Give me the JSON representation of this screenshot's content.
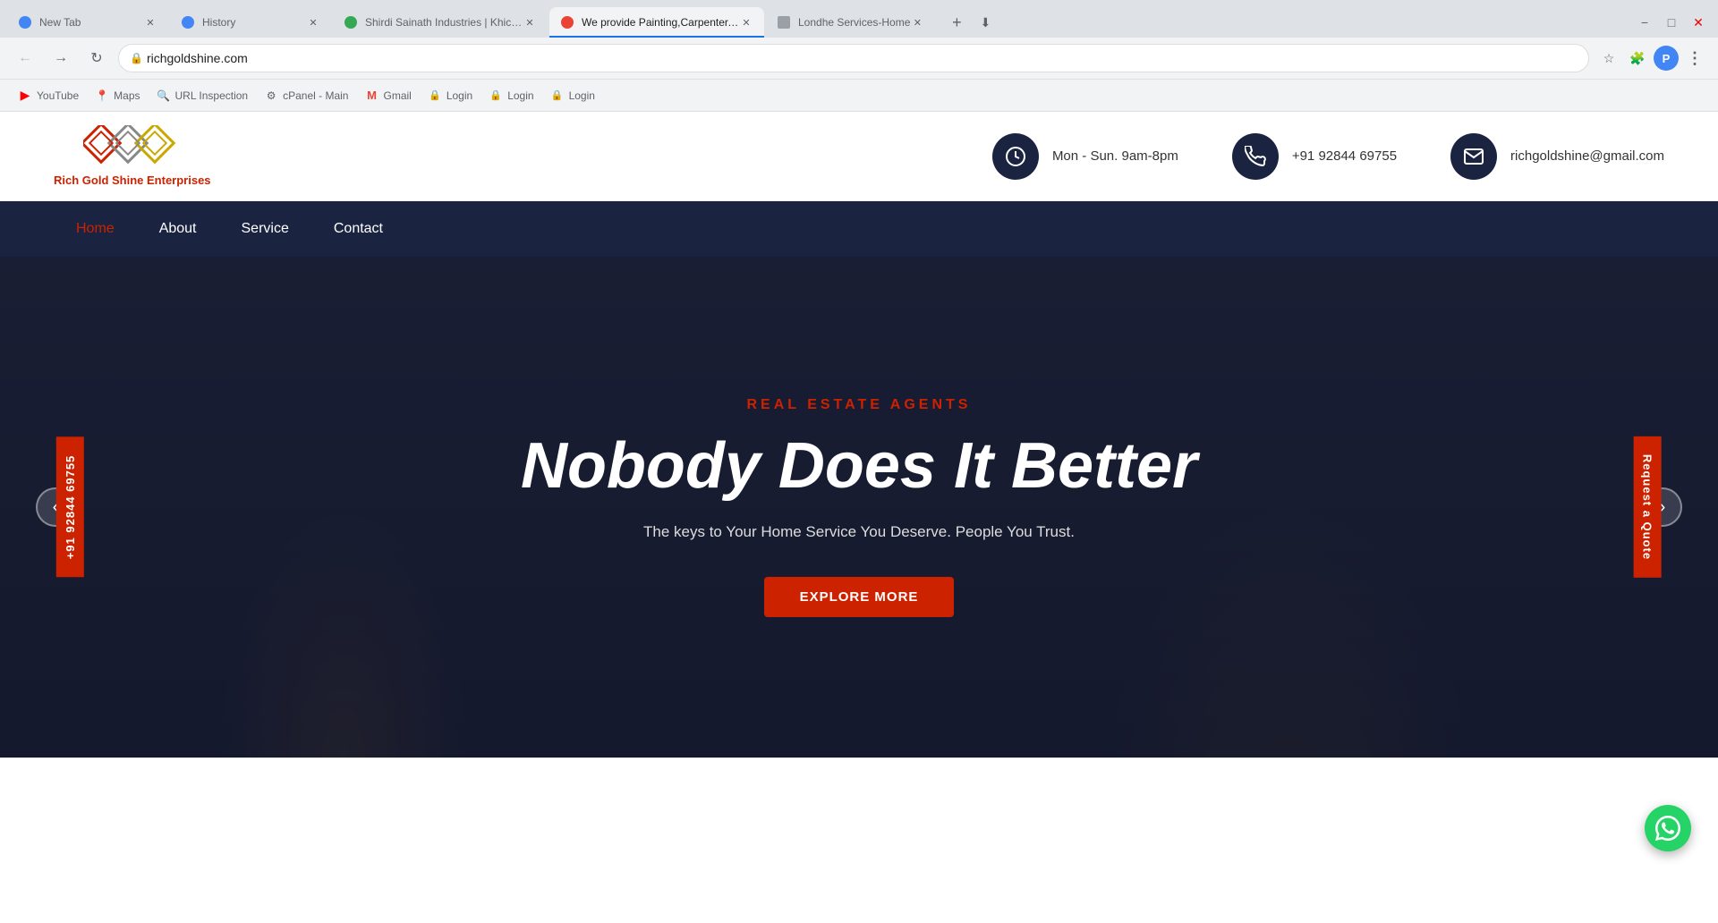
{
  "browser": {
    "tabs": [
      {
        "id": "new-tab",
        "title": "New Tab",
        "favicon": "blue",
        "active": false
      },
      {
        "id": "history",
        "title": "History",
        "favicon": "blue",
        "active": false
      },
      {
        "id": "shirdi",
        "title": "Shirdi Sainath Industries | Khichdi",
        "favicon": "green",
        "active": false
      },
      {
        "id": "painting",
        "title": "We provide Painting,Carpenter,D...",
        "favicon": "red",
        "active": true
      },
      {
        "id": "londhe",
        "title": "Londhe Services-Home",
        "favicon": "gray",
        "active": false
      }
    ],
    "address": "richgoldshine.com",
    "bookmarks": [
      {
        "id": "youtube",
        "label": "YouTube",
        "icon": "▶"
      },
      {
        "id": "maps",
        "label": "Maps",
        "icon": "📍"
      },
      {
        "id": "url-inspection",
        "label": "URL Inspection",
        "icon": "🔗"
      },
      {
        "id": "cpanel",
        "label": "cPanel - Main",
        "icon": "⚙"
      },
      {
        "id": "gmail",
        "label": "Gmail",
        "icon": "M"
      },
      {
        "id": "login1",
        "label": "Login",
        "icon": "🔒"
      },
      {
        "id": "login2",
        "label": "Login",
        "icon": "🔒"
      },
      {
        "id": "login3",
        "label": "Login",
        "icon": "🔒"
      }
    ]
  },
  "website": {
    "logo": {
      "name": "Rich Gold Shine Enterprises",
      "tagline": "Rich Gold Shine Enterprises"
    },
    "contact": {
      "hours": "Mon - Sun. 9am-8pm",
      "phone": "+91 92844 69755",
      "email": "richgoldshine@gmail.com"
    },
    "nav": {
      "items": [
        {
          "id": "home",
          "label": "Home",
          "active": true
        },
        {
          "id": "about",
          "label": "About",
          "active": false
        },
        {
          "id": "service",
          "label": "Service",
          "active": false
        },
        {
          "id": "contact",
          "label": "Contact",
          "active": false
        }
      ]
    },
    "hero": {
      "subtitle": "REAL ESTATE AGENTS",
      "title": "Nobody Does It Better",
      "description": "The keys to Your Home Service You Deserve. People You Trust.",
      "cta": "Explore More",
      "phone_side": "+91 92844 69755",
      "quote_side": "Request a Quote"
    }
  }
}
